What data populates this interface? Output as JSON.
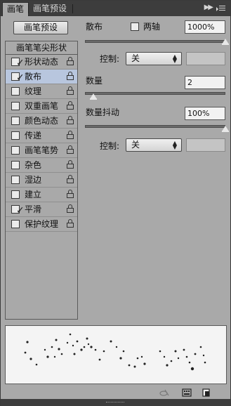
{
  "tabs": [
    {
      "label": "画笔",
      "active": true
    },
    {
      "label": "画笔预设",
      "active": false
    }
  ],
  "preset_button": "画笔预设",
  "list_header": "画笔笔尖形状",
  "brush_items": [
    {
      "label": "形状动态",
      "checked": true,
      "selected": false
    },
    {
      "label": "散布",
      "checked": true,
      "selected": true
    },
    {
      "label": "纹理",
      "checked": false,
      "selected": false
    },
    {
      "label": "双重画笔",
      "checked": false,
      "selected": false
    },
    {
      "label": "颜色动态",
      "checked": false,
      "selected": false
    },
    {
      "label": "传递",
      "checked": false,
      "selected": false
    },
    {
      "label": "画笔笔势",
      "checked": false,
      "selected": false
    },
    {
      "label": "杂色",
      "checked": false,
      "selected": false
    },
    {
      "label": "湿边",
      "checked": false,
      "selected": false
    },
    {
      "label": "建立",
      "checked": false,
      "selected": false
    },
    {
      "label": "平滑",
      "checked": true,
      "selected": false
    },
    {
      "label": "保护纹理",
      "checked": false,
      "selected": false
    }
  ],
  "scatter": {
    "label": "散布",
    "both_axes_label": "两轴",
    "both_axes_checked": false,
    "value": "1000%",
    "slider_fraction": 1.0
  },
  "control1": {
    "label": "控制:",
    "value": "关"
  },
  "count": {
    "label": "数量",
    "value": "2",
    "slider_fraction": 0.06
  },
  "count_jitter": {
    "label": "数量抖动",
    "value": "100%",
    "slider_fraction": 1.0
  },
  "control2": {
    "label": "控制:",
    "value": "关"
  },
  "icons": {
    "checkmark": "✓",
    "dropdown": "▲▼"
  }
}
